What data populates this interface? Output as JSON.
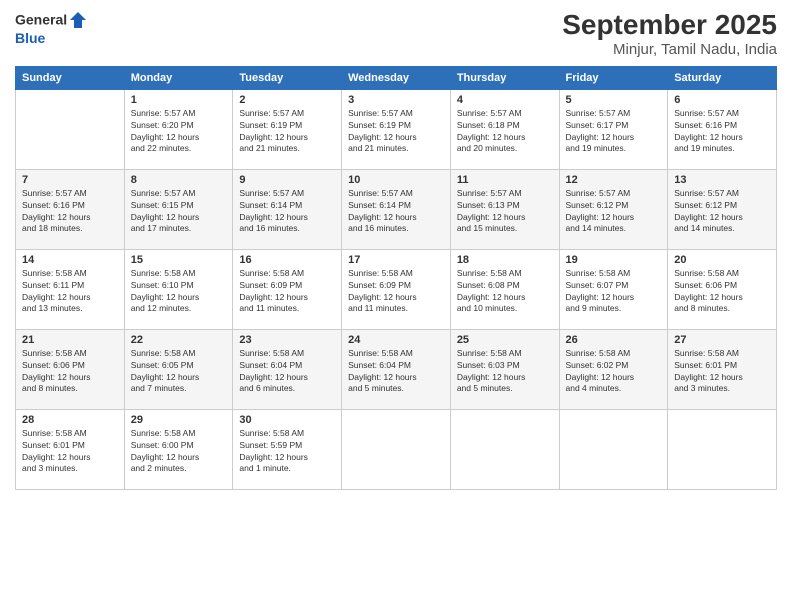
{
  "header": {
    "logo_line1": "General",
    "logo_line2": "Blue",
    "title": "September 2025",
    "subtitle": "Minjur, Tamil Nadu, India"
  },
  "weekdays": [
    "Sunday",
    "Monday",
    "Tuesday",
    "Wednesday",
    "Thursday",
    "Friday",
    "Saturday"
  ],
  "weeks": [
    [
      {
        "day": "",
        "info": ""
      },
      {
        "day": "1",
        "info": "Sunrise: 5:57 AM\nSunset: 6:20 PM\nDaylight: 12 hours\nand 22 minutes."
      },
      {
        "day": "2",
        "info": "Sunrise: 5:57 AM\nSunset: 6:19 PM\nDaylight: 12 hours\nand 21 minutes."
      },
      {
        "day": "3",
        "info": "Sunrise: 5:57 AM\nSunset: 6:19 PM\nDaylight: 12 hours\nand 21 minutes."
      },
      {
        "day": "4",
        "info": "Sunrise: 5:57 AM\nSunset: 6:18 PM\nDaylight: 12 hours\nand 20 minutes."
      },
      {
        "day": "5",
        "info": "Sunrise: 5:57 AM\nSunset: 6:17 PM\nDaylight: 12 hours\nand 19 minutes."
      },
      {
        "day": "6",
        "info": "Sunrise: 5:57 AM\nSunset: 6:16 PM\nDaylight: 12 hours\nand 19 minutes."
      }
    ],
    [
      {
        "day": "7",
        "info": "Sunrise: 5:57 AM\nSunset: 6:16 PM\nDaylight: 12 hours\nand 18 minutes."
      },
      {
        "day": "8",
        "info": "Sunrise: 5:57 AM\nSunset: 6:15 PM\nDaylight: 12 hours\nand 17 minutes."
      },
      {
        "day": "9",
        "info": "Sunrise: 5:57 AM\nSunset: 6:14 PM\nDaylight: 12 hours\nand 16 minutes."
      },
      {
        "day": "10",
        "info": "Sunrise: 5:57 AM\nSunset: 6:14 PM\nDaylight: 12 hours\nand 16 minutes."
      },
      {
        "day": "11",
        "info": "Sunrise: 5:57 AM\nSunset: 6:13 PM\nDaylight: 12 hours\nand 15 minutes."
      },
      {
        "day": "12",
        "info": "Sunrise: 5:57 AM\nSunset: 6:12 PM\nDaylight: 12 hours\nand 14 minutes."
      },
      {
        "day": "13",
        "info": "Sunrise: 5:57 AM\nSunset: 6:12 PM\nDaylight: 12 hours\nand 14 minutes."
      }
    ],
    [
      {
        "day": "14",
        "info": "Sunrise: 5:58 AM\nSunset: 6:11 PM\nDaylight: 12 hours\nand 13 minutes."
      },
      {
        "day": "15",
        "info": "Sunrise: 5:58 AM\nSunset: 6:10 PM\nDaylight: 12 hours\nand 12 minutes."
      },
      {
        "day": "16",
        "info": "Sunrise: 5:58 AM\nSunset: 6:09 PM\nDaylight: 12 hours\nand 11 minutes."
      },
      {
        "day": "17",
        "info": "Sunrise: 5:58 AM\nSunset: 6:09 PM\nDaylight: 12 hours\nand 11 minutes."
      },
      {
        "day": "18",
        "info": "Sunrise: 5:58 AM\nSunset: 6:08 PM\nDaylight: 12 hours\nand 10 minutes."
      },
      {
        "day": "19",
        "info": "Sunrise: 5:58 AM\nSunset: 6:07 PM\nDaylight: 12 hours\nand 9 minutes."
      },
      {
        "day": "20",
        "info": "Sunrise: 5:58 AM\nSunset: 6:06 PM\nDaylight: 12 hours\nand 8 minutes."
      }
    ],
    [
      {
        "day": "21",
        "info": "Sunrise: 5:58 AM\nSunset: 6:06 PM\nDaylight: 12 hours\nand 8 minutes."
      },
      {
        "day": "22",
        "info": "Sunrise: 5:58 AM\nSunset: 6:05 PM\nDaylight: 12 hours\nand 7 minutes."
      },
      {
        "day": "23",
        "info": "Sunrise: 5:58 AM\nSunset: 6:04 PM\nDaylight: 12 hours\nand 6 minutes."
      },
      {
        "day": "24",
        "info": "Sunrise: 5:58 AM\nSunset: 6:04 PM\nDaylight: 12 hours\nand 5 minutes."
      },
      {
        "day": "25",
        "info": "Sunrise: 5:58 AM\nSunset: 6:03 PM\nDaylight: 12 hours\nand 5 minutes."
      },
      {
        "day": "26",
        "info": "Sunrise: 5:58 AM\nSunset: 6:02 PM\nDaylight: 12 hours\nand 4 minutes."
      },
      {
        "day": "27",
        "info": "Sunrise: 5:58 AM\nSunset: 6:01 PM\nDaylight: 12 hours\nand 3 minutes."
      }
    ],
    [
      {
        "day": "28",
        "info": "Sunrise: 5:58 AM\nSunset: 6:01 PM\nDaylight: 12 hours\nand 3 minutes."
      },
      {
        "day": "29",
        "info": "Sunrise: 5:58 AM\nSunset: 6:00 PM\nDaylight: 12 hours\nand 2 minutes."
      },
      {
        "day": "30",
        "info": "Sunrise: 5:58 AM\nSunset: 5:59 PM\nDaylight: 12 hours\nand 1 minute."
      },
      {
        "day": "",
        "info": ""
      },
      {
        "day": "",
        "info": ""
      },
      {
        "day": "",
        "info": ""
      },
      {
        "day": "",
        "info": ""
      }
    ]
  ]
}
